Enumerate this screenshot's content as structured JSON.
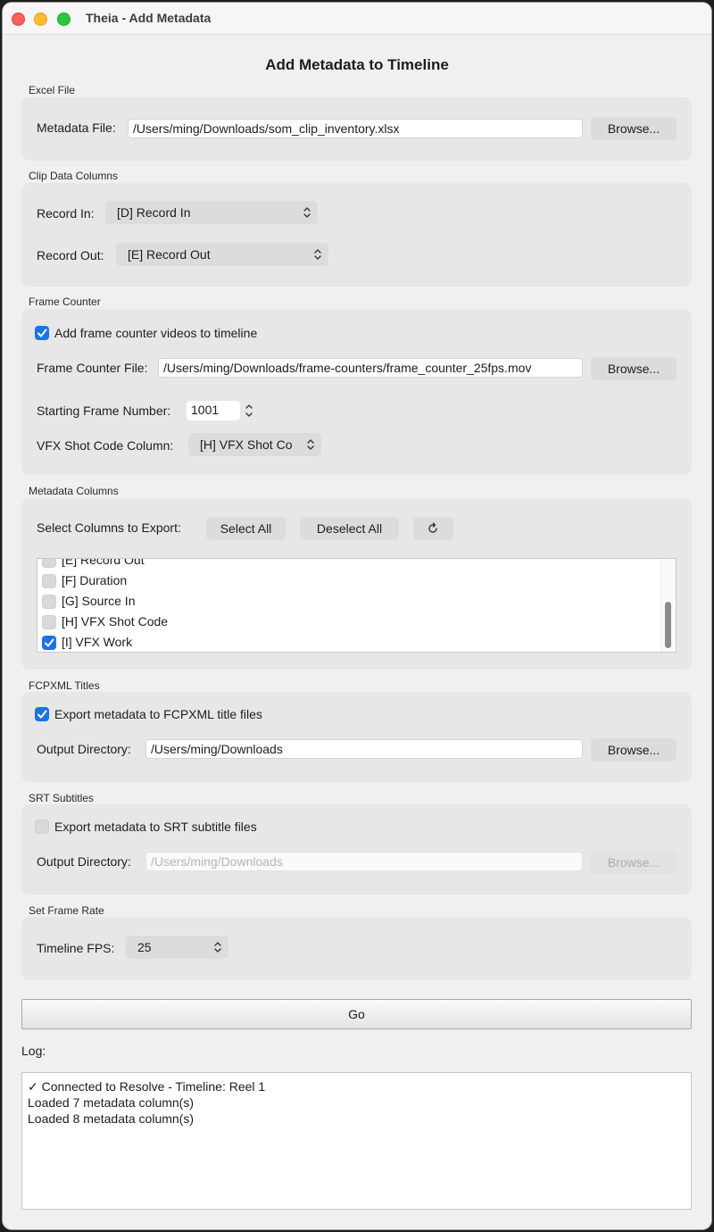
{
  "window": {
    "title": "Theia - Add Metadata"
  },
  "page_title": "Add Metadata to Timeline",
  "excel": {
    "section": "Excel File",
    "file_label": "Metadata File:",
    "file_value": "/Users/ming/Downloads/som_clip_inventory.xlsx",
    "browse": "Browse..."
  },
  "clip": {
    "section": "Clip Data Columns",
    "record_in_label": "Record In:",
    "record_in_value": "[D] Record In",
    "record_out_label": "Record Out:",
    "record_out_value": "[E] Record Out"
  },
  "frame_counter": {
    "section": "Frame Counter",
    "add_checkbox_label": "Add frame counter videos to timeline",
    "add_checked": true,
    "file_label": "Frame Counter File:",
    "file_value": "/Users/ming/Downloads/frame-counters/frame_counter_25fps.mov",
    "browse": "Browse...",
    "start_label": "Starting Frame Number:",
    "start_value": "1001",
    "shot_code_label": "VFX Shot Code Column:",
    "shot_code_value": "[H] VFX Shot Co"
  },
  "metadata": {
    "section": "Metadata Columns",
    "select_label": "Select Columns to Export:",
    "select_all": "Select All",
    "deselect_all": "Deselect All",
    "refresh_icon": "refresh-icon",
    "items": [
      {
        "label": "[E] Record Out",
        "checked": false
      },
      {
        "label": "[F] Duration",
        "checked": false
      },
      {
        "label": "[G] Source In",
        "checked": false
      },
      {
        "label": "[H] VFX Shot Code",
        "checked": false
      },
      {
        "label": "[I] VFX Work",
        "checked": true
      }
    ]
  },
  "fcpxml": {
    "section": "FCPXML Titles",
    "export_label": "Export metadata to FCPXML title files",
    "export_checked": true,
    "dir_label": "Output Directory:",
    "dir_value": "/Users/ming/Downloads",
    "browse": "Browse..."
  },
  "srt": {
    "section": "SRT Subtitles",
    "export_label": "Export metadata to SRT subtitle files",
    "export_checked": false,
    "dir_label": "Output Directory:",
    "dir_placeholder": "/Users/ming/Downloads",
    "browse": "Browse..."
  },
  "frame_rate": {
    "section": "Set Frame Rate",
    "fps_label": "Timeline FPS:",
    "fps_value": "25"
  },
  "go": "Go",
  "log": {
    "label": "Log:",
    "lines": [
      "✓ Connected to Resolve - Timeline: Reel 1",
      "Loaded 7 metadata column(s)",
      "Loaded 8 metadata column(s)"
    ]
  },
  "colors": {
    "accent": "#1a73e8",
    "group_bg": "#e7e7e7",
    "window_bg": "#f0f0f0"
  }
}
